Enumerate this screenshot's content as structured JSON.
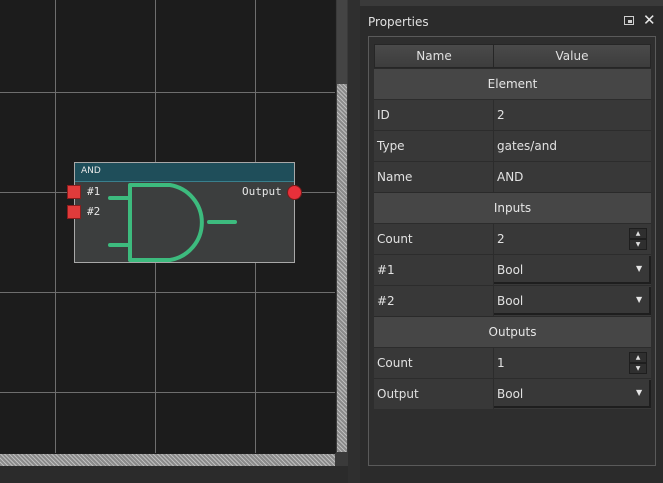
{
  "node": {
    "title": "AND",
    "inputs": [
      {
        "label": "#1"
      },
      {
        "label": "#2"
      }
    ],
    "output": {
      "label": "Output"
    }
  },
  "properties": {
    "title": "Properties",
    "columns": {
      "name": "Name",
      "value": "Value"
    },
    "sections": {
      "element": {
        "title": "Element",
        "rows": [
          {
            "name": "ID",
            "value": "2"
          },
          {
            "name": "Type",
            "value": "gates/and"
          },
          {
            "name": "Name",
            "value": "AND"
          }
        ]
      },
      "inputs": {
        "title": "Inputs",
        "rows": [
          {
            "name": "Count",
            "value": "2"
          },
          {
            "name": "#1",
            "value": "Bool"
          },
          {
            "name": "#2",
            "value": "Bool"
          }
        ]
      },
      "outputs": {
        "title": "Outputs",
        "rows": [
          {
            "name": "Count",
            "value": "1"
          },
          {
            "name": "Output",
            "value": "Bool"
          }
        ]
      }
    }
  },
  "colors": {
    "port_input": "#e03b3b",
    "port_output": "#e8303a",
    "gate_symbol": "#3dbb7e",
    "node_header": "#1f4e5a"
  },
  "icons": [
    "float-panel-icon",
    "close-icon",
    "spin-up-icon",
    "spin-down-icon",
    "dropdown-arrow-icon"
  ]
}
